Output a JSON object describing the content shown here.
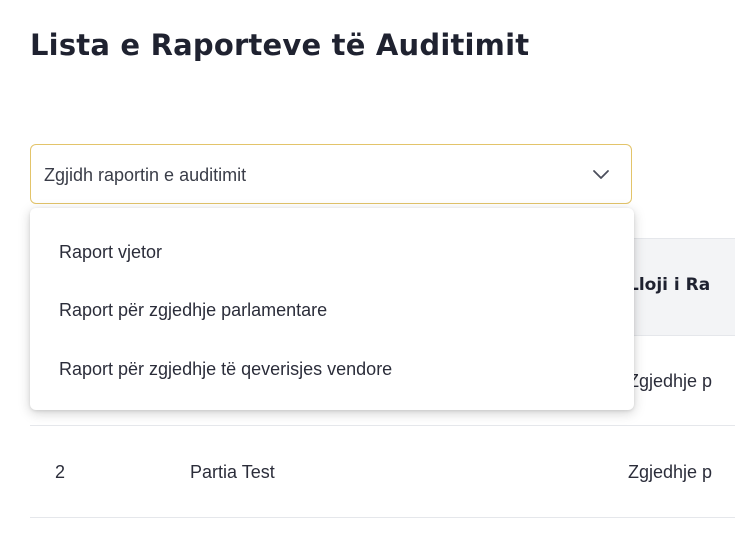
{
  "page": {
    "title": "Lista e Raporteve të Auditimit"
  },
  "select": {
    "value": "Zgjidh raportin e auditimit",
    "icon": "chevron-down-icon",
    "border_color": "#e3c46a"
  },
  "dropdown": {
    "options": [
      "Raport vjetor",
      "Raport për zgjedhje parlamentare",
      "Raport për zgjedhje të qeverisjes vendore"
    ]
  },
  "table": {
    "headers": [
      "Lloji i Ra"
    ],
    "rows": [
      {
        "no": "",
        "party": "",
        "type": "Zgjedhje p"
      },
      {
        "no": "2",
        "party": "Partia Test",
        "type": "Zgjedhje p"
      }
    ]
  }
}
